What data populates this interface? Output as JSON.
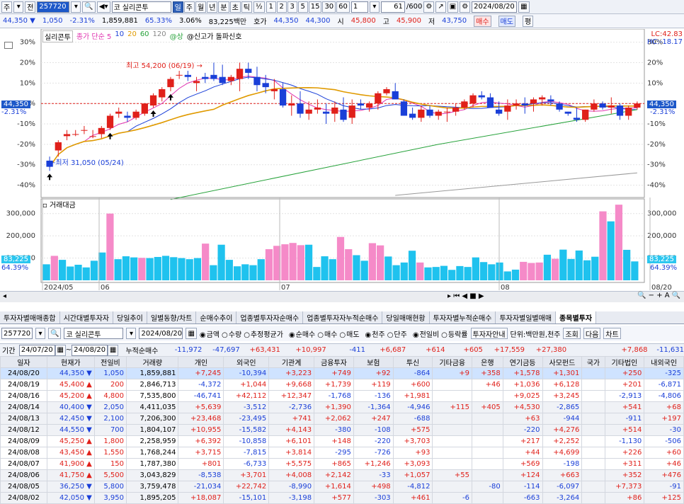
{
  "toolbar": {
    "left_items": [
      "주",
      "▾",
      "전"
    ],
    "code": "257720",
    "market_tag": "코",
    "stock_name": "실리콘투",
    "period_buttons": [
      "일",
      "주",
      "월",
      "년",
      "분",
      "초",
      "틱"
    ],
    "active_period": "일",
    "fraction": "½",
    "minute_buttons": [
      "1",
      "2",
      "3",
      "5",
      "15",
      "30",
      "60"
    ],
    "dropdown_value": "1",
    "count": "61",
    "count_total": "/600",
    "date": "2024/08/20"
  },
  "quote": {
    "price": "44,350",
    "change": "1,050",
    "change_pct": "-2.31%",
    "volume": "1,859,881",
    "ratio": "65.33%",
    "ratio2": "3.06%",
    "amount": "83,225백만",
    "bid_label": "호가",
    "bid": "44,350",
    "ask": "44,300",
    "open_label": "시",
    "open": "45,800",
    "high_label": "고",
    "high": "45,900",
    "low_label": "저",
    "low": "43,750",
    "buy_label": "매수",
    "sell_label": "매도",
    "eval_label": "평"
  },
  "chart_data": [
    {
      "type": "candlestick",
      "title": "실리콘투",
      "legend": [
        "종가 단순 5",
        "10",
        "20",
        "60",
        "120",
        "@상",
        "@신고가 돌파신호"
      ],
      "y_ticks": [
        "30%",
        "20%",
        "10%",
        "0%",
        "-10%",
        "-20%",
        "-30%",
        "-40%"
      ],
      "ylim": [
        -45,
        33
      ],
      "high_note": "최고 54,200 (06/19) →",
      "low_note": "←최저 31,050 (05/24)",
      "price_tag": "44,350",
      "pct_tag": "-2.31%",
      "lc": "LC:42.83",
      "hc": "HC:-18.17",
      "x_labels": [
        "2024/05",
        "06",
        "07",
        "08",
        "08/20"
      ],
      "candles_pct": [
        [
          -28,
          -26,
          -33,
          -31
        ],
        [
          -23,
          -18,
          -26,
          -19
        ],
        [
          -16,
          -13,
          -18,
          -15
        ],
        [
          -15,
          -13,
          -16,
          -15
        ],
        [
          -13,
          -11,
          -15,
          -13
        ],
        [
          -16,
          -13,
          -17,
          -16
        ],
        [
          -15,
          -11,
          -17,
          -12
        ],
        [
          -12,
          -5,
          -13,
          -6
        ],
        [
          -5,
          -2,
          -7,
          -4
        ],
        [
          -6,
          -4,
          -9,
          -7
        ],
        [
          -7,
          -3,
          -8,
          -4
        ],
        [
          -5,
          -1,
          -6,
          0
        ],
        [
          -1,
          5,
          -2,
          4
        ],
        [
          3,
          8,
          1,
          7
        ],
        [
          8,
          13,
          6,
          12
        ],
        [
          14,
          16,
          12,
          14
        ],
        [
          14,
          16,
          11,
          13
        ],
        [
          10,
          13,
          6,
          11
        ],
        [
          13,
          15,
          10,
          12
        ],
        [
          14,
          20,
          11,
          12
        ],
        [
          13,
          19,
          9,
          10
        ],
        [
          11,
          14,
          9,
          13
        ],
        [
          12,
          20,
          6,
          17
        ],
        [
          17,
          20,
          12,
          15
        ],
        [
          13,
          18,
          6,
          9
        ],
        [
          10,
          14,
          5,
          8
        ],
        [
          6,
          12,
          2,
          7
        ],
        [
          7,
          10,
          -2,
          -1
        ],
        [
          -1,
          4,
          -6,
          0
        ],
        [
          0,
          6,
          -7,
          -5
        ],
        [
          -5,
          1,
          -8,
          -3
        ],
        [
          -3,
          2,
          -5,
          -2
        ],
        [
          -4,
          0,
          -10,
          -5
        ],
        [
          -5,
          1,
          -9,
          -2
        ],
        [
          -3,
          3,
          -9,
          -8
        ],
        [
          -7,
          2,
          -10,
          -1
        ],
        [
          0,
          2,
          -3,
          -1
        ],
        [
          -2,
          1,
          -4,
          0
        ],
        [
          0,
          6,
          -3,
          5
        ],
        [
          5,
          8,
          4,
          7
        ],
        [
          6,
          10,
          3,
          2
        ],
        [
          1,
          2,
          -6,
          -6
        ],
        [
          -5,
          -2,
          -8,
          -7
        ],
        [
          -7,
          -1,
          -9,
          -3
        ],
        [
          -3,
          -1,
          -7,
          -6
        ],
        [
          -6,
          -3,
          -8,
          -4
        ],
        [
          -4,
          -2,
          -9,
          -4
        ],
        [
          -4,
          0,
          -6,
          -2
        ],
        [
          -2,
          2,
          -3,
          1
        ],
        [
          0,
          5,
          -2,
          4
        ],
        [
          4,
          6,
          2,
          3
        ],
        [
          3,
          5,
          -1,
          -2
        ],
        [
          -3,
          1,
          -6,
          -5
        ],
        [
          -4,
          2,
          -8,
          -1
        ],
        [
          -1,
          2,
          -3,
          0
        ],
        [
          0,
          3,
          -5,
          -1
        ],
        [
          0,
          3,
          -4,
          2
        ],
        [
          2,
          4,
          -1,
          3
        ],
        [
          2,
          4,
          -1,
          1
        ],
        [
          0,
          1,
          -4,
          -3
        ],
        [
          -4,
          -6,
          -4,
          -5
        ],
        [
          -7,
          -2,
          -9,
          -8
        ],
        [
          -8,
          -3,
          -9,
          -3
        ],
        [
          -3,
          2,
          -4,
          0
        ],
        [
          0,
          1,
          -3,
          -2
        ],
        [
          -2,
          3,
          -5,
          -1
        ],
        [
          -1,
          0,
          -8,
          -6
        ],
        [
          -6,
          -1,
          -8,
          -2
        ],
        [
          -2,
          1,
          -3,
          0
        ]
      ]
    },
    {
      "type": "bar",
      "title": "거래대금",
      "y_ticks": [
        "300,000",
        "200,000",
        "100,000"
      ],
      "ylim": [
        0,
        350000
      ],
      "value_tag": "83,225",
      "pct_tag": "64.39%",
      "values": [
        72000,
        110000,
        92000,
        62000,
        70000,
        58000,
        88000,
        125000,
        300000,
        95000,
        108000,
        103000,
        101000,
        100000,
        105000,
        110000,
        104000,
        100000,
        95000,
        100000,
        165000,
        68000,
        160000,
        92000,
        63000,
        72000,
        68000,
        95000,
        140000,
        155000,
        162000,
        168000,
        158000,
        160000,
        60000,
        108000,
        95000,
        195000,
        140000,
        113000,
        88000,
        167000,
        157000,
        107000,
        68000,
        80000,
        133000,
        80000,
        58000,
        60000,
        65000,
        47000,
        64000,
        60000,
        103000,
        82000,
        72000,
        80000,
        40000,
        48000,
        83000,
        78000,
        80000,
        115000,
        97000,
        138000,
        96000,
        134000,
        90000,
        106000,
        310000,
        265000,
        340000,
        137000,
        85000
      ],
      "colors_pink_idx": [
        1,
        8,
        12,
        20,
        28,
        29,
        30,
        31,
        32,
        37,
        38,
        41,
        42,
        47,
        60,
        61,
        62,
        64,
        70,
        72
      ]
    }
  ],
  "tabs": [
    "투자자별매매종합",
    "시간대별투자자",
    "당일추이",
    "일별동향/차트",
    "순매수추이",
    "업종별투자자순매수",
    "업종별투자자누적순매수",
    "당일매매현황",
    "투자자별누적순매수",
    "투자자별일별매매",
    "종목별투자"
  ],
  "active_tab": "종목별투자",
  "filter": {
    "code": "257720",
    "market_tag": "코",
    "stock_name": "실리콘투",
    "date": "2024/08/20",
    "r1": [
      "금액",
      "수량",
      "추정평균가"
    ],
    "r2": [
      "순매수",
      "매수",
      "매도"
    ],
    "r3": [
      "천주",
      "단주"
    ],
    "r4": [
      "전일비",
      "등락률"
    ],
    "info_button": "투자자안내",
    "unit": "단위:백만원,천주",
    "query_button": "조회",
    "next_button": "다음",
    "chart_button": "차트"
  },
  "period": {
    "label": "기간",
    "from": "24/07/20",
    "to": "24/08/20",
    "sum_label": "누적순매수",
    "sums": [
      "-11,972",
      "-47,697",
      "+63,431",
      "+10,997",
      "-411",
      "+6,687",
      "+614",
      "+605",
      "+17,559",
      "+27,380",
      "",
      "+7,868",
      "-11,631"
    ]
  },
  "table": {
    "headers": [
      "일자",
      "현재가",
      "전일비",
      "거래량",
      "개인",
      "외국인",
      "기관계",
      "금융투자",
      "보험",
      "투신",
      "기타금융",
      "은행",
      "연기금등",
      "사모펀드",
      "국가",
      "기타법인",
      "내외국인"
    ],
    "rows": [
      [
        "24/08/20",
        "44,350 ▼",
        "1,050",
        "1,859,881",
        "+7,245",
        "-10,394",
        "+3,223",
        "+749",
        "+92",
        "-864",
        "+9",
        "+358",
        "+1,578",
        "+1,301",
        "",
        "+250",
        "-325"
      ],
      [
        "24/08/19",
        "45,400 ▲",
        "200",
        "2,846,713",
        "-4,372",
        "+1,044",
        "+9,668",
        "+1,739",
        "+119",
        "+600",
        "",
        "+46",
        "+1,036",
        "+6,128",
        "",
        "+201",
        "-6,871"
      ],
      [
        "24/08/16",
        "45,200 ▲",
        "4,800",
        "7,535,800",
        "-46,741",
        "+42,112",
        "+12,347",
        "-1,768",
        "-136",
        "+1,981",
        "",
        "",
        "+9,025",
        "+3,245",
        "",
        "-2,913",
        "-4,806"
      ],
      [
        "24/08/14",
        "40,400 ▼",
        "2,050",
        "4,411,035",
        "+5,639",
        "-3,512",
        "-2,736",
        "+1,390",
        "-1,364",
        "-4,946",
        "+115",
        "+405",
        "+4,530",
        "-2,865",
        "",
        "+541",
        "+68"
      ],
      [
        "24/08/13",
        "42,450 ▼",
        "2,100",
        "7,206,300",
        "+23,468",
        "-23,495",
        "+741",
        "+2,062",
        "+247",
        "-688",
        "",
        "",
        "+63",
        "-944",
        "",
        "-911",
        "+197"
      ],
      [
        "24/08/12",
        "44,550 ▼",
        "700",
        "1,804,107",
        "+10,955",
        "-15,582",
        "+4,143",
        "-380",
        "-108",
        "+575",
        "",
        "",
        "-220",
        "+4,276",
        "",
        "+514",
        "-30"
      ],
      [
        "24/08/09",
        "45,250 ▲",
        "1,800",
        "2,258,959",
        "+6,392",
        "-10,858",
        "+6,101",
        "+148",
        "-220",
        "+3,703",
        "",
        "",
        "+217",
        "+2,252",
        "",
        "-1,130",
        "-506"
      ],
      [
        "24/08/08",
        "43,450 ▲",
        "1,550",
        "1,768,244",
        "+3,715",
        "-7,815",
        "+3,814",
        "-295",
        "-726",
        "+93",
        "",
        "",
        "+44",
        "+4,699",
        "",
        "+226",
        "+60"
      ],
      [
        "24/08/07",
        "41,900 ▲",
        "150",
        "1,787,380",
        "+801",
        "-6,733",
        "+5,575",
        "+865",
        "+1,246",
        "+3,093",
        "",
        "",
        "+569",
        "-198",
        "",
        "+311",
        "+46"
      ],
      [
        "24/08/06",
        "41,750 ▲",
        "5,500",
        "3,043,829",
        "-8,538",
        "+3,701",
        "+4,008",
        "+2,142",
        "-33",
        "+1,057",
        "+55",
        "",
        "+124",
        "+663",
        "",
        "+352",
        "+476"
      ],
      [
        "24/08/05",
        "36,250 ▼",
        "5,800",
        "3,759,478",
        "-21,034",
        "+22,742",
        "-8,990",
        "+1,614",
        "+498",
        "-4,812",
        "",
        "-80",
        "-114",
        "-6,097",
        "",
        "+7,373",
        "-91"
      ],
      [
        "24/08/02",
        "42,050 ▼",
        "3,950",
        "1,895,205",
        "+18,087",
        "-15,101",
        "-3,198",
        "+577",
        "-303",
        "+461",
        "-6",
        "",
        "-663",
        "-3,264",
        "",
        "+86",
        "+125"
      ]
    ]
  }
}
